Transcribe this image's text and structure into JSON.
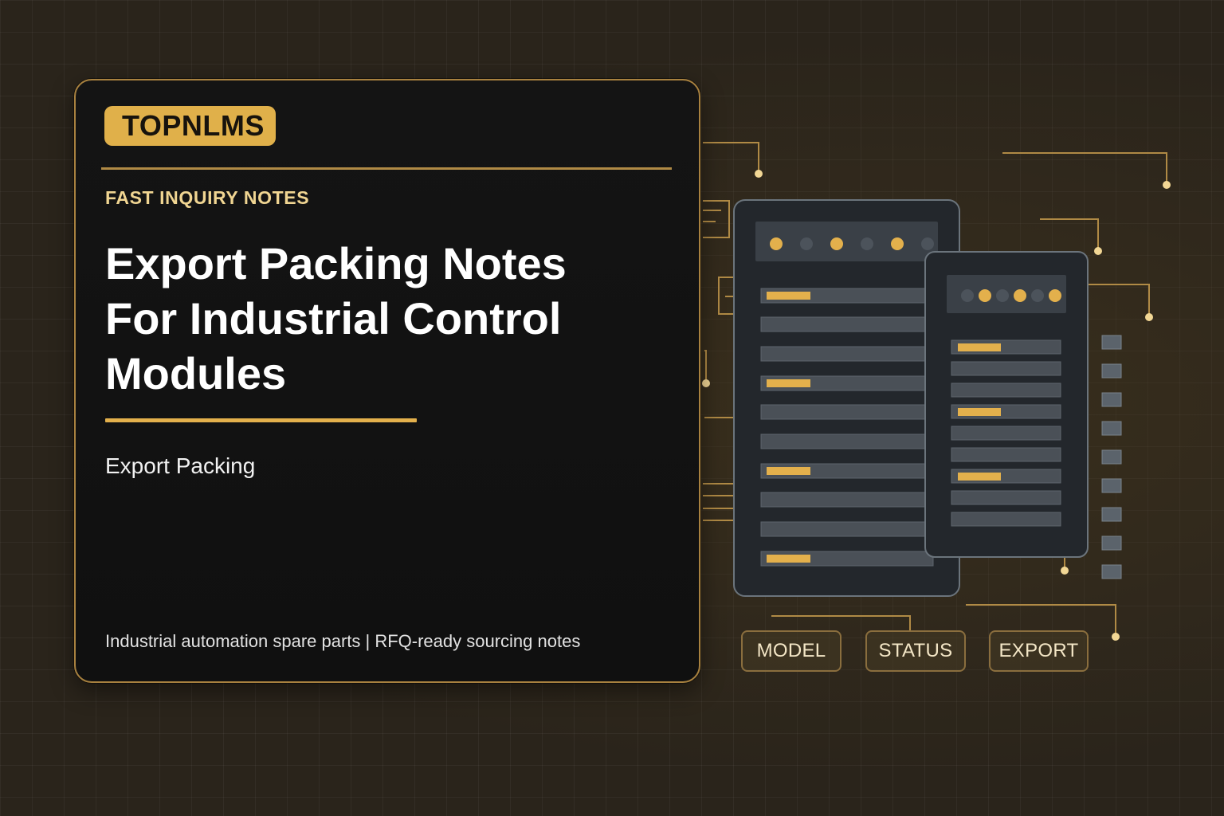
{
  "brand": {
    "name": "TOPNLMS"
  },
  "eyebrow": "FAST INQUIRY NOTES",
  "headline": "Export Packing Notes For Industrial Control Modules",
  "tag": "Export Packing",
  "footer": "Industrial automation spare parts | RFQ-ready sourcing notes",
  "chips": [
    "MODEL",
    "STATUS",
    "EXPORT"
  ],
  "colors": {
    "gold": "#e3b04c",
    "gold_dim": "#a8813f",
    "card_bg": "#111111",
    "panel": "#23272c",
    "row": "#4a5057"
  },
  "icons": [
    "server-rack-illustration",
    "module-panel-illustration"
  ]
}
